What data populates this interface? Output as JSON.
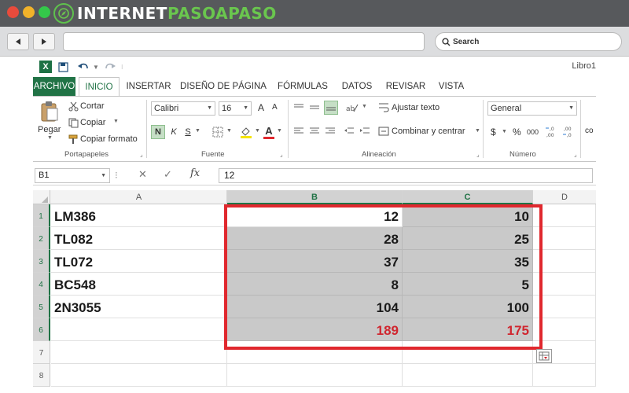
{
  "site": {
    "brand_prefix": "INTERNET",
    "brand_green": "PASOAPASO",
    "colors": {
      "titlebar": "#57595c",
      "brand_green": "#6ac64e",
      "excel_green": "#217346",
      "highlight_red": "#e0282e",
      "total_red": "#d0262f"
    }
  },
  "browser": {
    "back_icon": "triangle-left",
    "forward_icon": "triangle-right",
    "search_placeholder": "Search"
  },
  "excel": {
    "quick_access": {
      "save_icon": "save-icon",
      "undo_icon": "undo-icon",
      "redo_icon": "redo-icon"
    },
    "book_title": "Libro1",
    "tabs": [
      "ARCHIVO",
      "INICIO",
      "INSERTAR",
      "DISEÑO DE PÁGINA",
      "FÓRMULAS",
      "DATOS",
      "REVISAR",
      "VISTA"
    ],
    "ribbon": {
      "clipboard": {
        "paste": "Pegar",
        "cut": "Cortar",
        "copy": "Copiar",
        "format_painter": "Copiar formato",
        "group": "Portapapeles"
      },
      "font": {
        "name": "Calibri",
        "size": "16",
        "bold": "N",
        "italic": "K",
        "underline": "S",
        "font_color": "A",
        "grow": "A",
        "shrink": "A",
        "group": "Fuente"
      },
      "alignment": {
        "wrap": "Ajustar texto",
        "merge": "Combinar y centrar",
        "group": "Alineación"
      },
      "number": {
        "format": "General",
        "currency": "$",
        "percent": "%",
        "thousands": "000",
        "group": "Número"
      },
      "overflow": "co"
    },
    "formula_bar": {
      "name_box": "B1",
      "fx": "fx",
      "value": "12"
    },
    "columns": [
      "A",
      "B",
      "C",
      "D"
    ],
    "selected_columns": [
      "B",
      "C"
    ],
    "rows": [
      {
        "num": "1",
        "a": "LM386",
        "b": "12",
        "c": "10"
      },
      {
        "num": "2",
        "a": "TL082",
        "b": "28",
        "c": "25"
      },
      {
        "num": "3",
        "a": "TL072",
        "b": "37",
        "c": "35"
      },
      {
        "num": "4",
        "a": "BC548",
        "b": "8",
        "c": "5"
      },
      {
        "num": "5",
        "a": "2N3055",
        "b": "104",
        "c": "100"
      },
      {
        "num": "6",
        "a": "",
        "b": "189",
        "c": "175"
      },
      {
        "num": "7",
        "a": "",
        "b": "",
        "c": ""
      },
      {
        "num": "8",
        "a": "",
        "b": "",
        "c": ""
      }
    ]
  }
}
